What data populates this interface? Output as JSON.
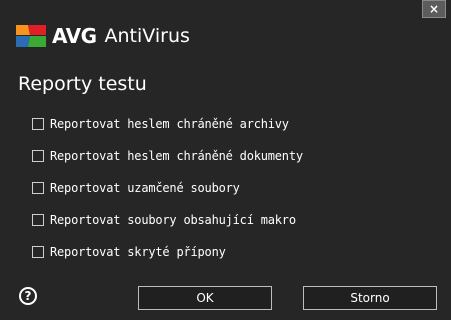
{
  "window": {
    "brand": "AVG",
    "product": "AntiVirus",
    "close_label": "×"
  },
  "dialog": {
    "heading": "Reporty testu",
    "options": [
      {
        "label": "Reportovat heslem chráněné archivy",
        "checked": false
      },
      {
        "label": "Reportovat heslem chráněné dokumenty",
        "checked": false
      },
      {
        "label": "Reportovat uzamčené soubory",
        "checked": false
      },
      {
        "label": "Reportovat soubory obsahující makro",
        "checked": false
      },
      {
        "label": "Reportovat skryté přípony",
        "checked": false
      }
    ]
  },
  "footer": {
    "help_icon": "?",
    "ok_label": "OK",
    "cancel_label": "Storno"
  },
  "colors": {
    "background": "#262626",
    "logo_orange": "#f7941d",
    "logo_red": "#e31f26",
    "logo_blue": "#2b6db4",
    "logo_green": "#3aaa35"
  }
}
